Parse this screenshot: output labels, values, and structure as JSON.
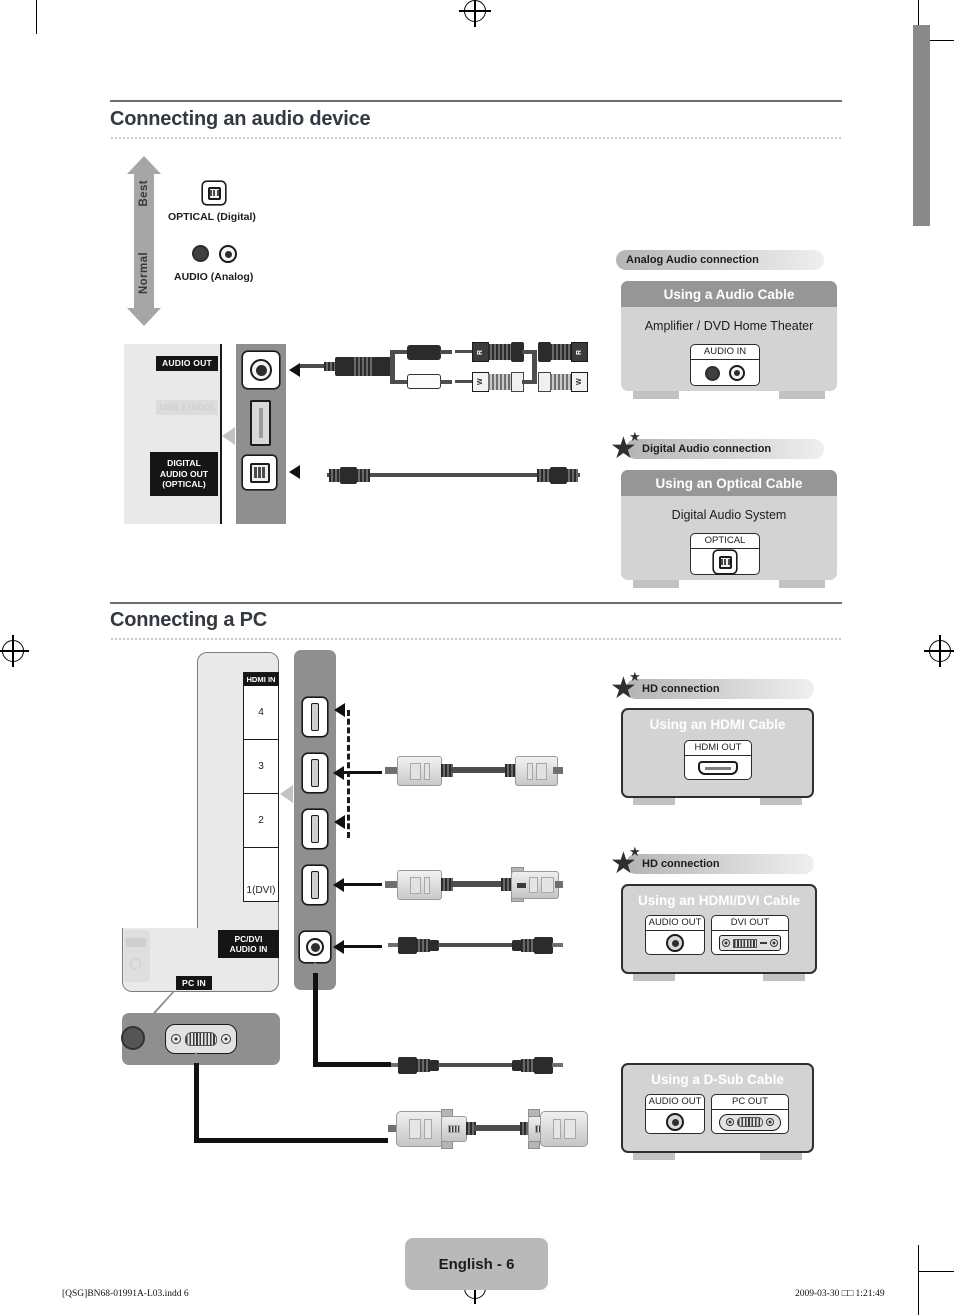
{
  "page": {
    "sections": [
      {
        "title": "Connecting an audio device"
      },
      {
        "title": "Connecting a PC"
      }
    ],
    "page_label": "English - 6",
    "footer_left": "[QSG]BN68-01991A-L03.indd   6",
    "footer_right": "2009-03-30   □□ 1:21:49"
  },
  "quality_scale": {
    "top_label": "Best",
    "bottom_label": "Normal",
    "entries": [
      {
        "icon": "optical-port-icon",
        "label": "OPTICAL (Digital)"
      },
      {
        "icon": "rca-pair-icon",
        "label": "AUDIO (Analog)"
      }
    ]
  },
  "audio_panel": {
    "ports": [
      {
        "name": "audio-out",
        "label": "AUDIO OUT",
        "type": "rca"
      },
      {
        "name": "usb-1-hdd",
        "label": "USB 1 (HDD)",
        "type": "usb",
        "dimmed": true
      },
      {
        "name": "digital-audio-out-optical",
        "label": "DIGITAL\nAUDIO OUT\n(OPTICAL)",
        "type": "optical"
      }
    ]
  },
  "audio_cables": [
    {
      "name": "rca-audio-cable",
      "left_label": "R",
      "right_label": "W"
    },
    {
      "name": "optical-cable"
    }
  ],
  "audio_blocks": [
    {
      "badge": "Analog Audio connection",
      "starred": false,
      "card_title": "Using a Audio Cable",
      "card_subtitle": "Amplifier / DVD Home Theater",
      "devices": [
        {
          "title": "AUDIO IN",
          "type": "rca-pair"
        }
      ]
    },
    {
      "badge": "Digital Audio connection",
      "starred": true,
      "card_title": "Using an Optical Cable",
      "card_subtitle": "Digital Audio System",
      "devices": [
        {
          "title": "OPTICAL",
          "type": "optical"
        }
      ]
    }
  ],
  "pc_panel": {
    "hdmi_group_label": "HDMI IN",
    "hdmi_ports": [
      "4",
      "3",
      "2",
      "1(DVI)"
    ],
    "audio_port_label": "PC/DVI\nAUDIO IN",
    "pc_in_label": "PC IN"
  },
  "pc_cables": [
    {
      "name": "hdmi-cable"
    },
    {
      "name": "hdmi-to-dvi-cable"
    },
    {
      "name": "audio-rca-cable"
    },
    {
      "name": "audio-rca-cable-2"
    },
    {
      "name": "d-sub-cable"
    }
  ],
  "pc_blocks": [
    {
      "badge": "HD connection",
      "starred": true,
      "card_title": "Using an HDMI Cable",
      "outlined": true,
      "devices": [
        {
          "title": "HDMI OUT",
          "type": "hdmi"
        }
      ]
    },
    {
      "badge": "HD connection",
      "starred": true,
      "card_title": "Using an HDMI/DVI Cable",
      "outlined": true,
      "devices": [
        {
          "title": "AUDIO OUT",
          "type": "rca-single"
        },
        {
          "title": "DVI OUT",
          "type": "dvi"
        }
      ]
    },
    {
      "badge": "",
      "starred": false,
      "card_title": "Using a D-Sub Cable",
      "outlined": true,
      "devices": [
        {
          "title": "AUDIO OUT",
          "type": "rca-single"
        },
        {
          "title": "PC OUT",
          "type": "vga"
        }
      ]
    }
  ],
  "colors": {
    "heading": "#333940",
    "card_head": "#969696",
    "card_body": "#d3d3d3",
    "panel_side": "#8f8f8f",
    "panel_face": "#e9e9e9"
  }
}
